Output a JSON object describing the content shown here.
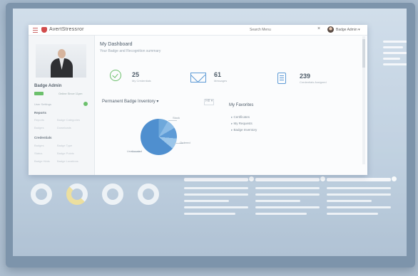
{
  "window": {
    "brand": "AvertStressror",
    "search_placeholder": "Search Menu",
    "close_glyph": "×",
    "user_name": "Badge Admin ▾"
  },
  "sidebar": {
    "title": "Badge Admin",
    "online_text": "Online Since 11pm",
    "menu_lines": [
      "User Settings",
      "Reports"
    ],
    "section_reports": "Reports",
    "report_items": [
      "Reports",
      "Badge Categories",
      "Badges",
      "Downloads"
    ],
    "section_credentials": "Credentials",
    "credential_items": [
      "Badges",
      "Badge Type",
      "Status",
      "Badge Points",
      "Badge Hints",
      "Badge Locations"
    ]
  },
  "dashboard": {
    "title": "My Dashboard",
    "subtitle": "Your Badge and Recognition summary"
  },
  "stats": [
    {
      "icon": "check-circle-icon",
      "value": "25",
      "label": "My Credentials"
    },
    {
      "icon": "mail-icon",
      "value": "61",
      "label": "Messages"
    },
    {
      "icon": "document-icon",
      "value": "239",
      "label": "Credentials Assigned"
    }
  ],
  "inventory": {
    "title": "Permanent Badge Inventory ▾",
    "controls": "Fill ▾",
    "pie_labels": [
      "Stock",
      "Ordered",
      "Unallocated"
    ]
  },
  "favorites": {
    "title": "My Favorites",
    "items": [
      "Certificates",
      "My Requests",
      "Badge Inventory"
    ]
  },
  "colors": {
    "accent": "#5e9bd6",
    "success": "#6cbf6c",
    "brand_red": "#d14b4b"
  }
}
